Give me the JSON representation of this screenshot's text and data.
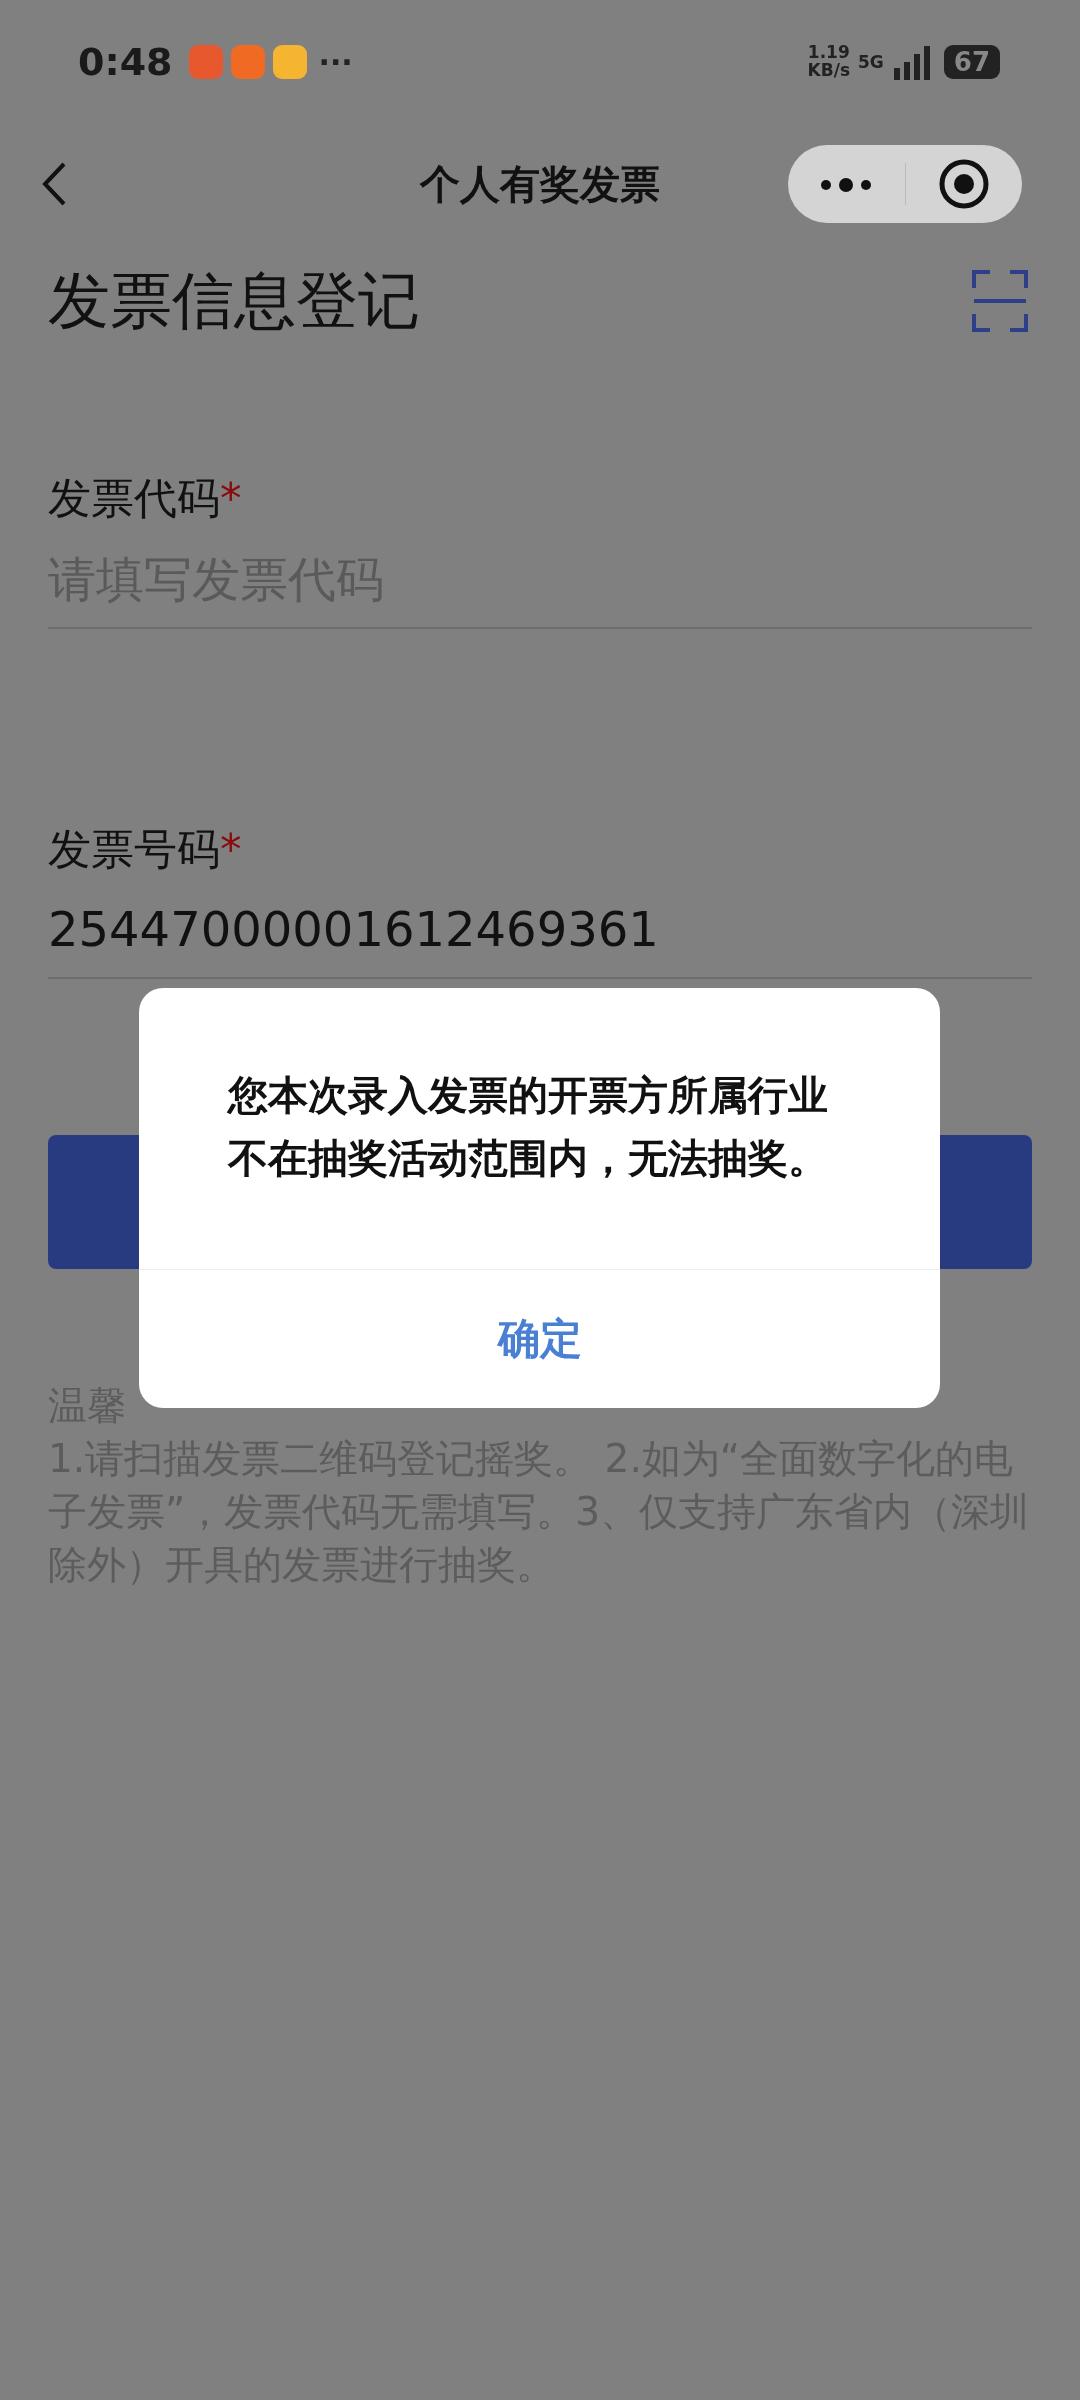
{
  "status_bar": {
    "time": "0:48",
    "more": "···",
    "speed_value": "1.19",
    "speed_unit": "KB/s",
    "network": "5G",
    "battery": "67"
  },
  "nav": {
    "title": "个人有奖发票"
  },
  "page_title": "发票信息登记",
  "fields": [
    {
      "label": "发票代码",
      "required_mark": "*",
      "placeholder": "请填写发票代码"
    },
    {
      "label": "发票号码",
      "required_mark": "*",
      "value": "25447000001612469361"
    }
  ],
  "tips": {
    "heading": "温馨",
    "text": "1.请扫描发票二维码登记摇奖。 2.如为“全面数字化的电子发票”，发票代码无需填写。3、仅支持广东省内（深圳除外）开具的发票进行抽奖。"
  },
  "dialog": {
    "message": "您本次录入发票的开票方所属行业不在抽奖活动范围内，无法抽奖。",
    "button": "确定"
  }
}
